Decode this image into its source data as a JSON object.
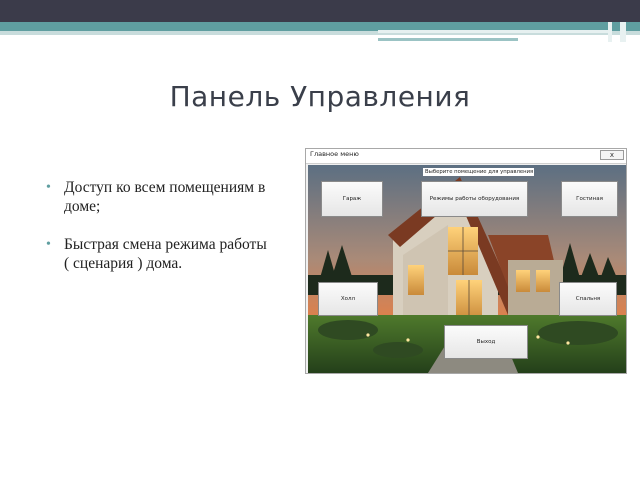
{
  "slide": {
    "title": "Панель Управления",
    "bullets": [
      "Доступ ко всем помещениям в доме;",
      "Быстрая смена режима работы ( сценария ) дома."
    ]
  },
  "window": {
    "title": "Главное меню",
    "close_label": "x",
    "hint": "Выберите помещение для управления",
    "buttons": {
      "garage": "Гараж",
      "modes": "Режимы работы оборудования",
      "living_room": "Гостиная",
      "hall": "Холл",
      "bedroom": "Спальня",
      "exit": "Выход"
    }
  },
  "colors": {
    "bar_dark": "#3b3b4a",
    "bar_teal": "#5f9ea0",
    "title_text": "#3a3f4a"
  }
}
